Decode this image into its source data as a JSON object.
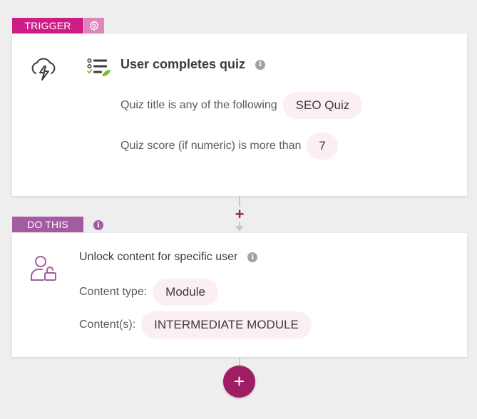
{
  "trigger": {
    "tag_label": "TRIGGER",
    "gear_icon": "gear-icon",
    "title": "User completes quiz",
    "conditions": [
      {
        "label": "Quiz title is any of the following",
        "value": "SEO Quiz"
      },
      {
        "label": "Quiz score (if numeric) is more than",
        "value": "7"
      }
    ]
  },
  "action": {
    "tag_label": "DO THIS",
    "title": "Unlock content for specific user",
    "fields": [
      {
        "label": "Content type:",
        "value": "Module"
      },
      {
        "label": "Content(s):",
        "value": "INTERMEDIATE MODULE"
      }
    ]
  },
  "info_glyph": "i",
  "add_glyph": "+",
  "colors": {
    "trigger_accent": "#cc1e86",
    "action_accent": "#a45ba2",
    "add_button": "#a01d63",
    "pill_bg": "#fbeef4"
  }
}
